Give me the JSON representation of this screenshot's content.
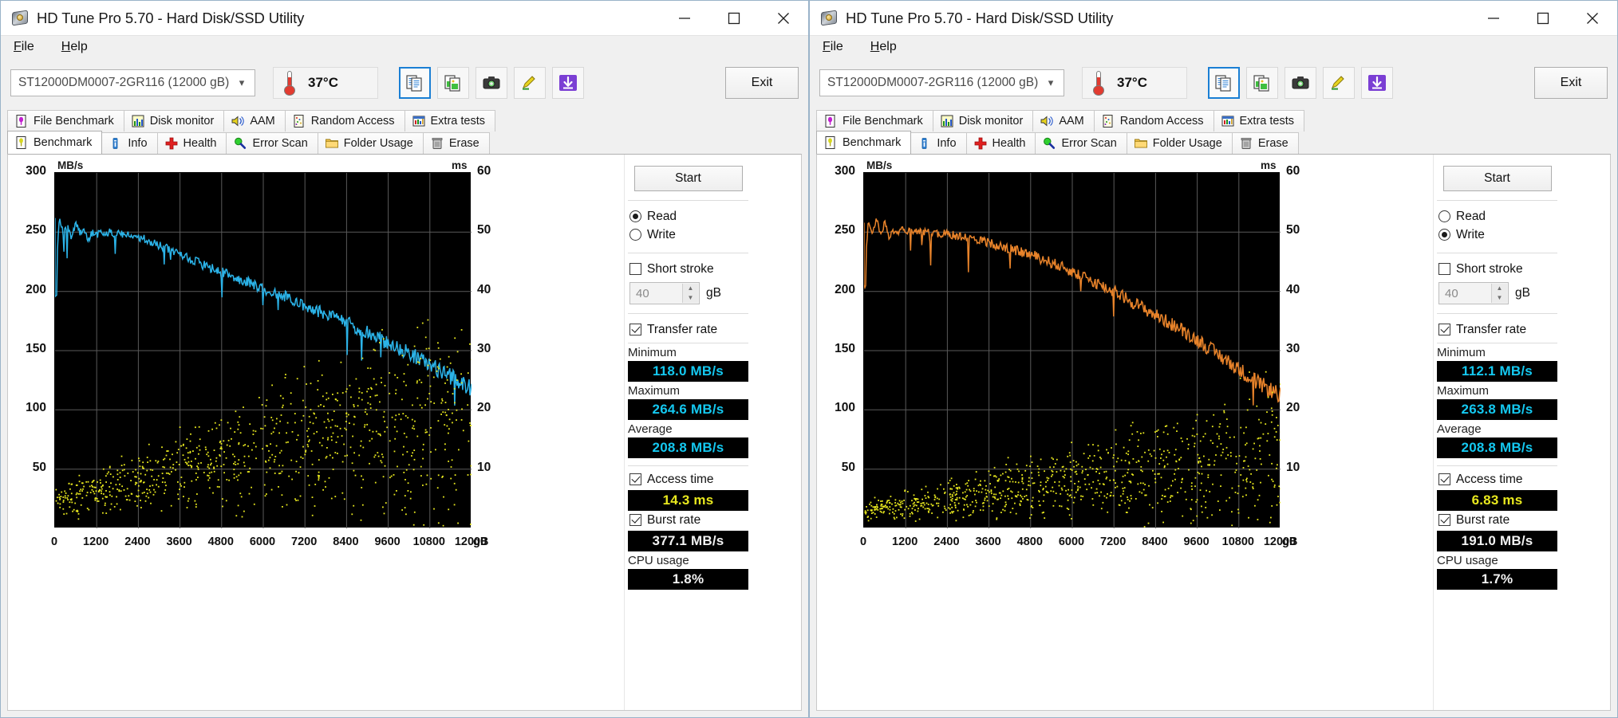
{
  "windows": [
    {
      "id": "left",
      "title": "HD Tune Pro 5.70 - Hard Disk/SSD Utility",
      "menu": [
        "File",
        "Help"
      ],
      "toolbar": {
        "device": "ST12000DM0007-2GR116 (12000 gB)",
        "temperature": "37°C",
        "exit_label": "Exit",
        "icons": [
          "copy-icon",
          "copy-image-icon",
          "screenshot-icon",
          "highlighter-icon",
          "save-icon"
        ]
      },
      "tabs_row1": [
        "File Benchmark",
        "Disk monitor",
        "AAM",
        "Random Access",
        "Extra tests"
      ],
      "tabs_row2": [
        "Benchmark",
        "Info",
        "Health",
        "Error Scan",
        "Folder Usage",
        "Erase"
      ],
      "active_tab": "Benchmark",
      "panel": {
        "start_label": "Start",
        "mode_read": "Read",
        "mode_write": "Write",
        "mode_selected": "Read",
        "short_stroke_label": "Short stroke",
        "short_stroke_checked": false,
        "short_stroke_value": "40",
        "short_stroke_unit": "gB",
        "transfer_rate_label": "Transfer rate",
        "transfer_rate_checked": true,
        "minimum_label": "Minimum",
        "minimum_value": "118.0 MB/s",
        "maximum_label": "Maximum",
        "maximum_value": "264.6 MB/s",
        "average_label": "Average",
        "average_value": "208.8 MB/s",
        "access_time_label": "Access time",
        "access_time_checked": true,
        "access_time_value": "14.3 ms",
        "burst_rate_label": "Burst rate",
        "burst_rate_checked": true,
        "burst_rate_value": "377.1 MB/s",
        "cpu_usage_label": "CPU usage",
        "cpu_usage_value": "1.8%"
      },
      "chart_data": {
        "type": "line",
        "title": "",
        "ylabel": "MB/s",
        "ylabel_right": "ms",
        "xlabel": "gB",
        "xlim": [
          0,
          12000
        ],
        "ylim": [
          0,
          300
        ],
        "ylim_right": [
          0,
          60
        ],
        "yticks": [
          0,
          50,
          100,
          150,
          200,
          250,
          300
        ],
        "yticks_right": [
          0,
          10,
          20,
          30,
          40,
          50,
          60
        ],
        "xticks": [
          0,
          1200,
          2400,
          3600,
          4800,
          6000,
          7200,
          8400,
          9600,
          10800,
          12000
        ],
        "grid": true,
        "series": [
          {
            "name": "Transfer rate",
            "color": "#2bb3e8",
            "unit": "MB/s",
            "x": [
              0,
              120,
              240,
              360,
              480,
              600,
              720,
              840,
              960,
              1080,
              1200,
              1320,
              1440,
              1560,
              1680,
              1800,
              1920,
              2040,
              2160,
              2280,
              2400,
              2520,
              2640,
              2760,
              2880,
              3000,
              3120,
              3240,
              3360,
              3480,
              3600,
              3720,
              3840,
              3960,
              4080,
              4200,
              4320,
              4440,
              4560,
              4680,
              4800,
              4920,
              5040,
              5160,
              5280,
              5400,
              5520,
              5640,
              5760,
              5880,
              6000,
              6120,
              6240,
              6360,
              6480,
              6600,
              6720,
              6840,
              6960,
              7080,
              7200,
              7320,
              7440,
              7560,
              7680,
              7800,
              7920,
              8040,
              8160,
              8280,
              8400,
              8520,
              8640,
              8760,
              8880,
              9000,
              9120,
              9240,
              9360,
              9480,
              9600,
              9720,
              9840,
              9960,
              10080,
              10200,
              10320,
              10440,
              10560,
              10680,
              10800,
              10920,
              11040,
              11160,
              11280,
              11400,
              11520,
              11640,
              11760,
              11880,
              12000
            ],
            "y": [
              195,
              262,
              248,
              256,
              245,
              258,
              249,
              252,
              244,
              250,
              247,
              252,
              248,
              250,
              249,
              249,
              248,
              248,
              247,
              247,
              246,
              245,
              243,
              241,
              240,
              239,
              238,
              236,
              235,
              233,
              231,
              230,
              228,
              226,
              225,
              223,
              222,
              220,
              219,
              218,
              216,
              215,
              214,
              212,
              211,
              210,
              208,
              207,
              205,
              204,
              202,
              201,
              200,
              198,
              197,
              196,
              194,
              193,
              191,
              190,
              188,
              187,
              185,
              184,
              182,
              181,
              179,
              178,
              176,
              175,
              173,
              172,
              170,
              168,
              167,
              165,
              163,
              162,
              160,
              158,
              157,
              155,
              153,
              151,
              150,
              148,
              146,
              144,
              142,
              140,
              138,
              136,
              134,
              132,
              130,
              128,
              126,
              124,
              122,
              120,
              118
            ]
          },
          {
            "name": "Access time",
            "color": "#e8e81e",
            "unit": "ms",
            "description": "scatter cloud of access-time samples rising from ~5 ms at 0 gB to ~22 ms at 12000 gB",
            "mean_start_ms": 5,
            "mean_end_ms": 21
          }
        ]
      }
    },
    {
      "id": "right",
      "title": "HD Tune Pro 5.70 - Hard Disk/SSD Utility",
      "menu": [
        "File",
        "Help"
      ],
      "toolbar": {
        "device": "ST12000DM0007-2GR116 (12000 gB)",
        "temperature": "37°C",
        "exit_label": "Exit",
        "icons": [
          "copy-icon",
          "copy-image-icon",
          "screenshot-icon",
          "highlighter-icon",
          "save-icon"
        ]
      },
      "tabs_row1": [
        "File Benchmark",
        "Disk monitor",
        "AAM",
        "Random Access",
        "Extra tests"
      ],
      "tabs_row2": [
        "Benchmark",
        "Info",
        "Health",
        "Error Scan",
        "Folder Usage",
        "Erase"
      ],
      "active_tab": "Benchmark",
      "panel": {
        "start_label": "Start",
        "mode_read": "Read",
        "mode_write": "Write",
        "mode_selected": "Write",
        "short_stroke_label": "Short stroke",
        "short_stroke_checked": false,
        "short_stroke_value": "40",
        "short_stroke_unit": "gB",
        "transfer_rate_label": "Transfer rate",
        "transfer_rate_checked": true,
        "minimum_label": "Minimum",
        "minimum_value": "112.1 MB/s",
        "maximum_label": "Maximum",
        "maximum_value": "263.8 MB/s",
        "average_label": "Average",
        "average_value": "208.8 MB/s",
        "access_time_label": "Access time",
        "access_time_checked": true,
        "access_time_value": "6.83 ms",
        "burst_rate_label": "Burst rate",
        "burst_rate_checked": true,
        "burst_rate_value": "191.0 MB/s",
        "cpu_usage_label": "CPU usage",
        "cpu_usage_value": "1.7%"
      },
      "chart_data": {
        "type": "line",
        "title": "",
        "ylabel": "MB/s",
        "ylabel_right": "ms",
        "xlabel": "gB",
        "xlim": [
          0,
          12000
        ],
        "ylim": [
          0,
          300
        ],
        "ylim_right": [
          0,
          60
        ],
        "yticks": [
          0,
          50,
          100,
          150,
          200,
          250,
          300
        ],
        "yticks_right": [
          0,
          10,
          20,
          30,
          40,
          50,
          60
        ],
        "xticks": [
          0,
          1200,
          2400,
          3600,
          4800,
          6000,
          7200,
          8400,
          9600,
          10800,
          12000
        ],
        "grid": true,
        "series": [
          {
            "name": "Transfer rate",
            "color": "#e8832a",
            "unit": "MB/s",
            "x": [
              0,
              120,
              240,
              360,
              480,
              600,
              720,
              840,
              960,
              1080,
              1200,
              1320,
              1440,
              1560,
              1680,
              1800,
              1920,
              2040,
              2160,
              2280,
              2400,
              2520,
              2640,
              2760,
              2880,
              3000,
              3120,
              3240,
              3360,
              3480,
              3600,
              3720,
              3840,
              3960,
              4080,
              4200,
              4320,
              4440,
              4560,
              4680,
              4800,
              4920,
              5040,
              5160,
              5280,
              5400,
              5520,
              5640,
              5760,
              5880,
              6000,
              6120,
              6240,
              6360,
              6480,
              6600,
              6720,
              6840,
              6960,
              7080,
              7200,
              7320,
              7440,
              7560,
              7680,
              7800,
              7920,
              8040,
              8160,
              8280,
              8400,
              8520,
              8640,
              8760,
              8880,
              9000,
              9120,
              9240,
              9360,
              9480,
              9600,
              9720,
              9840,
              9960,
              10080,
              10200,
              10320,
              10440,
              10560,
              10680,
              10800,
              10920,
              11040,
              11160,
              11280,
              11400,
              11520,
              11640,
              11760,
              11880,
              12000
            ],
            "y": [
              205,
              258,
              250,
              262,
              246,
              259,
              244,
              252,
              248,
              254,
              250,
              253,
              249,
              251,
              250,
              250,
              249,
              250,
              248,
              249,
              248,
              248,
              247,
              246,
              246,
              245,
              244,
              244,
              243,
              242,
              241,
              240,
              239,
              238,
              237,
              236,
              235,
              234,
              233,
              232,
              231,
              230,
              228,
              227,
              226,
              224,
              223,
              221,
              220,
              218,
              217,
              215,
              213,
              212,
              210,
              208,
              207,
              205,
              203,
              201,
              200,
              198,
              196,
              194,
              192,
              190,
              188,
              186,
              184,
              182,
              180,
              178,
              176,
              174,
              172,
              170,
              168,
              166,
              164,
              161,
              159,
              157,
              154,
              152,
              149,
              147,
              144,
              142,
              139,
              137,
              134,
              132,
              129,
              127,
              124,
              122,
              120,
              118,
              116,
              114,
              112
            ]
          },
          {
            "name": "Access time",
            "color": "#e8e81e",
            "unit": "ms",
            "description": "scatter cloud of access-time samples rising from ~3 ms at 0 gB to ~13 ms at 12000 gB",
            "mean_start_ms": 3,
            "mean_end_ms": 13
          }
        ]
      }
    }
  ]
}
